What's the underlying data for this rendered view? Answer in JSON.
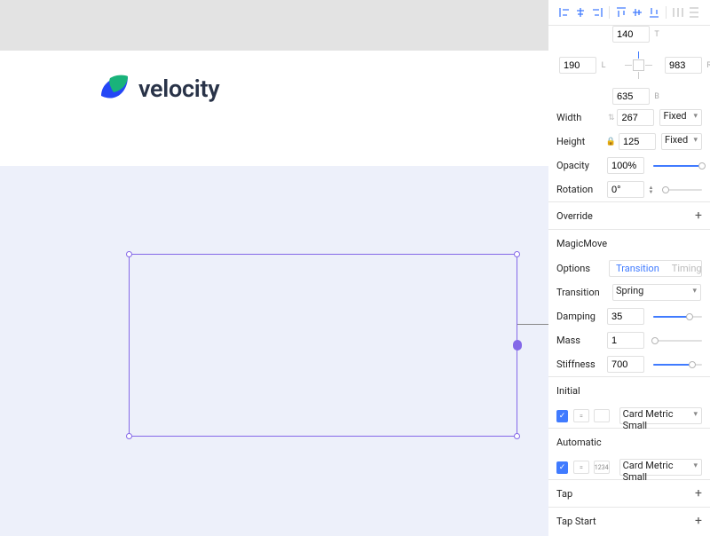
{
  "canvas": {
    "brand_text": "velocity"
  },
  "position": {
    "top": "140",
    "left": "190",
    "right": "983",
    "bottom": "635"
  },
  "size": {
    "width_label": "Width",
    "width": "267",
    "width_mode": "Fixed",
    "height_label": "Height",
    "height": "125",
    "height_mode": "Fixed"
  },
  "opacity": {
    "label": "Opacity",
    "value": "100%",
    "pct": 100
  },
  "rotation": {
    "label": "Rotation",
    "value": "0°",
    "pct": 0
  },
  "override": {
    "label": "Override"
  },
  "magicmove": {
    "title": "MagicMove",
    "options_label": "Options",
    "opt_transition": "Transition",
    "opt_timing": "Timing",
    "transition_label": "Transition",
    "transition_value": "Spring",
    "damping_label": "Damping",
    "damping_value": "35",
    "damping_pct": 75,
    "mass_label": "Mass",
    "mass_value": "1",
    "mass_pct": 4,
    "stiffness_label": "Stiffness",
    "stiffness_value": "700",
    "stiffness_pct": 80
  },
  "initial": {
    "label": "Initial",
    "target": "Card Metric Small",
    "eq": "="
  },
  "automatic": {
    "label": "Automatic",
    "target": "Card Metric Small",
    "eq": "=",
    "badge": "1234"
  },
  "tap": {
    "label": "Tap"
  },
  "tapstart": {
    "label": "Tap Start"
  }
}
